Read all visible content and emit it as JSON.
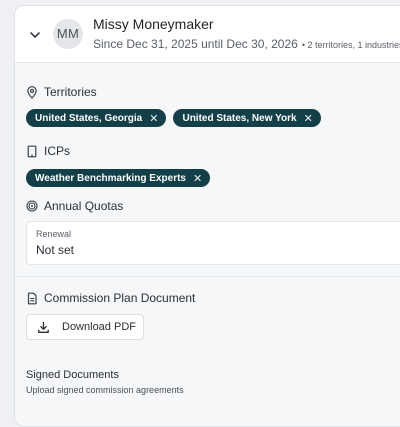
{
  "header": {
    "avatar_initials": "MM",
    "name": "Missy Moneymaker",
    "period": "Since Dec 31, 2025 until Dec 30, 2026",
    "counts": "• 2 territories, 1 industries"
  },
  "territories": {
    "title": "Territories",
    "icon": "location-pin-icon",
    "chips": [
      "United States, Georgia",
      "United States, New York"
    ]
  },
  "icps": {
    "title": "ICPs",
    "icon": "building-icon",
    "chips": [
      "Weather Benchmarking Experts"
    ]
  },
  "quotas": {
    "title": "Annual Quotas",
    "icon": "target-icon",
    "label": "Renewal",
    "value": "Not set"
  },
  "commission_plan": {
    "title": "Commission Plan Document",
    "icon": "document-icon",
    "button_label": "Download PDF"
  },
  "signed_documents": {
    "title": "Signed Documents",
    "subtitle": "Upload signed commission agreements"
  },
  "colors": {
    "chip_bg": "#133f48",
    "page_bg": "#eef0f3",
    "card_bg": "#ffffff"
  }
}
